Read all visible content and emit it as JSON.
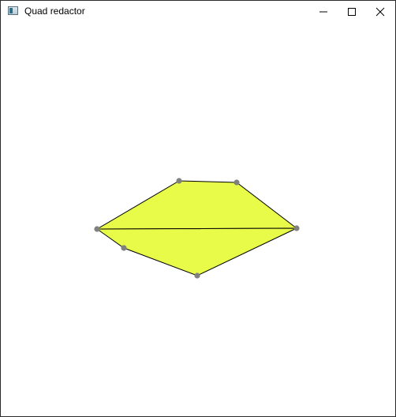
{
  "window": {
    "title": "Quad redactor"
  },
  "icons": {
    "app": "app-window-icon",
    "minimize": "minimize-icon",
    "maximize": "maximize-icon",
    "close": "close-icon"
  },
  "canvas": {
    "fill_color": "#e8fb48",
    "edge_color": "#000000",
    "vertex_color": "#808080"
  }
}
